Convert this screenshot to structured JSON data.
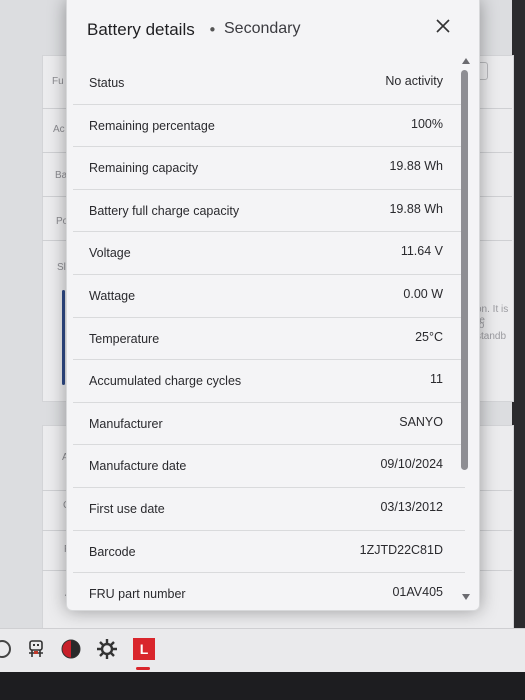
{
  "dialog": {
    "title": "Battery details",
    "separator": "•",
    "subtitle": "Secondary",
    "close_icon": "close-icon",
    "rows": [
      {
        "label": "Status",
        "value": "No activity"
      },
      {
        "label": "Remaining percentage",
        "value": "100%"
      },
      {
        "label": "Remaining capacity",
        "value": "19.88 Wh"
      },
      {
        "label": "Battery full charge capacity",
        "value": "19.88 Wh"
      },
      {
        "label": "Voltage",
        "value": "11.64 V"
      },
      {
        "label": "Wattage",
        "value": "0.00 W"
      },
      {
        "label": "Temperature",
        "value": "25°C"
      },
      {
        "label": "Accumulated charge cycles",
        "value": "11"
      },
      {
        "label": "Manufacturer",
        "value": "SANYO"
      },
      {
        "label": "Manufacture date",
        "value": "09/10/2024"
      },
      {
        "label": "First use date",
        "value": "03/13/2012"
      },
      {
        "label": "Barcode",
        "value": "1ZJTD22C81D"
      },
      {
        "label": "FRU part number",
        "value": "01AV405"
      }
    ]
  },
  "background": {
    "left_fragments": [
      "Fu",
      "Ac",
      "Ba",
      "Po",
      "Sl",
      "At",
      "Cu",
      "Fu",
      "Ac"
    ],
    "right_fragments": [
      "on. It is re",
      "to standb"
    ]
  },
  "taskbar": {
    "icons": [
      "circle-icon",
      "robot-icon",
      "red-ball-icon",
      "gear-icon",
      "lenovo-vantage-icon"
    ],
    "vantage_letter": "L"
  },
  "colors": {
    "dialog_bg": "#f4f4f6",
    "vantage_red": "#d9262c",
    "accent": "#2f4a86"
  }
}
